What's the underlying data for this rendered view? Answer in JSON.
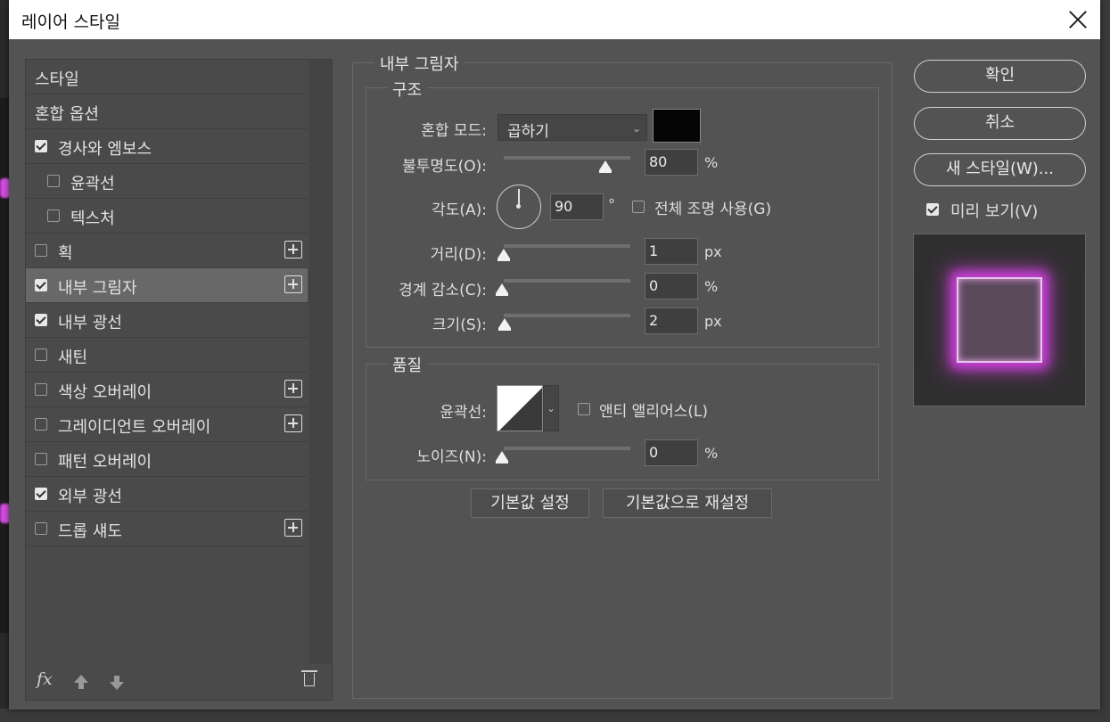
{
  "dialog": {
    "title": "레이어 스타일"
  },
  "style_list": {
    "items": [
      {
        "label": "스타일",
        "checkbox": false,
        "checked": false,
        "plus": false,
        "selected": false,
        "indent": false
      },
      {
        "label": "혼합 옵션",
        "checkbox": false,
        "checked": false,
        "plus": false,
        "selected": false,
        "indent": false
      },
      {
        "label": "경사와 엠보스",
        "checkbox": true,
        "checked": true,
        "plus": false,
        "selected": false,
        "indent": false
      },
      {
        "label": "윤곽선",
        "checkbox": true,
        "checked": false,
        "plus": false,
        "selected": false,
        "indent": true
      },
      {
        "label": "텍스처",
        "checkbox": true,
        "checked": false,
        "plus": false,
        "selected": false,
        "indent": true
      },
      {
        "label": "획",
        "checkbox": true,
        "checked": false,
        "plus": true,
        "selected": false,
        "indent": false
      },
      {
        "label": "내부 그림자",
        "checkbox": true,
        "checked": true,
        "plus": true,
        "selected": true,
        "indent": false
      },
      {
        "label": "내부 광선",
        "checkbox": true,
        "checked": true,
        "plus": false,
        "selected": false,
        "indent": false
      },
      {
        "label": "새틴",
        "checkbox": true,
        "checked": false,
        "plus": false,
        "selected": false,
        "indent": false
      },
      {
        "label": "색상 오버레이",
        "checkbox": true,
        "checked": false,
        "plus": true,
        "selected": false,
        "indent": false
      },
      {
        "label": "그레이디언트 오버레이",
        "checkbox": true,
        "checked": false,
        "plus": true,
        "selected": false,
        "indent": false
      },
      {
        "label": "패턴 오버레이",
        "checkbox": true,
        "checked": false,
        "plus": false,
        "selected": false,
        "indent": false
      },
      {
        "label": "외부 광선",
        "checkbox": true,
        "checked": true,
        "plus": false,
        "selected": false,
        "indent": false
      },
      {
        "label": "드롭 섀도",
        "checkbox": true,
        "checked": false,
        "plus": true,
        "selected": false,
        "indent": false
      }
    ],
    "footer": {
      "fx_label": "fx"
    }
  },
  "inner_shadow": {
    "section_title": "내부 그림자",
    "structure": {
      "title": "구조",
      "blend_mode_label": "혼합 모드:",
      "blend_mode_value": "곱하기",
      "shadow_color": "#050505",
      "opacity_label": "불투명도(O):",
      "opacity_value": "80",
      "opacity_unit": "%",
      "opacity_fraction": 0.8,
      "angle_label": "각도(A):",
      "angle_value": "90",
      "angle_unit": "°",
      "global_light_label": "전체 조명 사용(G)",
      "global_light_checked": false,
      "distance_label": "거리(D):",
      "distance_value": "1",
      "distance_unit": "px",
      "choke_label": "경계 감소(C):",
      "choke_value": "0",
      "choke_unit": "%",
      "size_label": "크기(S):",
      "size_value": "2",
      "size_unit": "px"
    },
    "quality": {
      "title": "품질",
      "contour_label": "윤곽선:",
      "anti_alias_label": "앤티 앨리어스(L)",
      "anti_alias_checked": false,
      "noise_label": "노이즈(N):",
      "noise_value": "0",
      "noise_unit": "%"
    },
    "make_default_label": "기본값 설정",
    "reset_default_label": "기본값으로 재설정"
  },
  "right_panel": {
    "ok_label": "확인",
    "cancel_label": "취소",
    "new_style_label": "새 스타일(W)...",
    "preview_label": "미리 보기(V)",
    "preview_checked": true,
    "glow_color": "#d23fe0"
  }
}
